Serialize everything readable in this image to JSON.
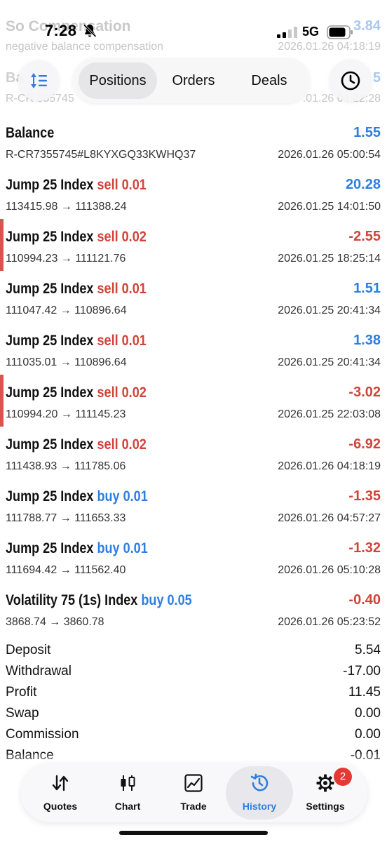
{
  "status_bar": {
    "time": "7:28",
    "network": "5G"
  },
  "top_ghost": {
    "title": "So Compensation",
    "subtitle": "negative balance compensation",
    "amount": "3.84",
    "datetime": "2026.01.26 04:18:19"
  },
  "top_ghost2": {
    "title": "Ba",
    "subtitle": "R-CR 355745",
    "amount": "5",
    "datetime": ".01.26 04:22:28"
  },
  "toolbar": {
    "tabs": [
      {
        "label": "Positions",
        "active": true
      },
      {
        "label": "Orders",
        "active": false
      },
      {
        "label": "Deals",
        "active": false
      }
    ]
  },
  "balance_row": {
    "title": "Balance",
    "comment": "R-CR7355745#L8KYXGQ33KWHQ37",
    "amount": "1.55",
    "datetime": "2026.01.26 05:00:54"
  },
  "deals": [
    {
      "symbol": "Jump 25 Index",
      "direction": "sell 0.01",
      "prices": "113415.98 → 111388.24",
      "profit": "20.28",
      "datetime": "2026.01.25 14:01:50",
      "loss": false
    },
    {
      "symbol": "Jump 25 Index",
      "direction": "sell 0.02",
      "prices": "110994.23 → 111121.76",
      "profit": "-2.55",
      "datetime": "2026.01.25 18:25:14",
      "loss": true
    },
    {
      "symbol": "Jump 25 Index",
      "direction": "sell 0.01",
      "prices": "111047.42 → 110896.64",
      "profit": "1.51",
      "datetime": "2026.01.25 20:41:34",
      "loss": false
    },
    {
      "symbol": "Jump 25 Index",
      "direction": "sell 0.01",
      "prices": "111035.01 → 110896.64",
      "profit": "1.38",
      "datetime": "2026.01.25 20:41:34",
      "loss": false
    },
    {
      "symbol": "Jump 25 Index",
      "direction": "sell 0.02",
      "prices": "110994.20 → 111145.23",
      "profit": "-3.02",
      "datetime": "2026.01.25 22:03:08",
      "loss": true
    },
    {
      "symbol": "Jump 25 Index",
      "direction": "sell 0.02",
      "prices": "111438.93 → 111785.06",
      "profit": "-6.92",
      "datetime": "2026.01.26 04:18:19",
      "loss": true
    },
    {
      "symbol": "Jump 25 Index",
      "direction": "buy 0.01",
      "prices": "111788.77 → 111653.33",
      "profit": "-1.35",
      "datetime": "2026.01.26 04:57:27",
      "loss": true
    },
    {
      "symbol": "Jump 25 Index",
      "direction": "buy 0.01",
      "prices": "111694.42 → 111562.40",
      "profit": "-1.32",
      "datetime": "2026.01.26 05:10:28",
      "loss": true
    },
    {
      "symbol": "Volatility 75 (1s) Index",
      "direction": "buy 0.05",
      "prices": "3868.74 → 3860.78",
      "profit": "-0.40",
      "datetime": "2026.01.26 05:23:52",
      "loss": true
    }
  ],
  "summary": [
    {
      "label": "Deposit",
      "value": "5.54"
    },
    {
      "label": "Withdrawal",
      "value": "-17.00"
    },
    {
      "label": "Profit",
      "value": "11.45"
    },
    {
      "label": "Swap",
      "value": "0.00"
    },
    {
      "label": "Commission",
      "value": "0.00"
    },
    {
      "label": "Balance",
      "value": "-0.01"
    }
  ],
  "tabbar": {
    "tabs": [
      {
        "label": "Quotes",
        "icon": "quotes-icon",
        "active": false
      },
      {
        "label": "Chart",
        "icon": "candlestick-icon",
        "active": false
      },
      {
        "label": "Trade",
        "icon": "trade-chart-icon",
        "active": false
      },
      {
        "label": "History",
        "icon": "history-icon",
        "active": true
      },
      {
        "label": "Settings",
        "icon": "gear-icon",
        "active": false
      }
    ],
    "settings_badge": "2"
  },
  "colors": {
    "accent": "#2f7de0",
    "loss": "#d0443a",
    "loss_bar": "#d9534f"
  }
}
